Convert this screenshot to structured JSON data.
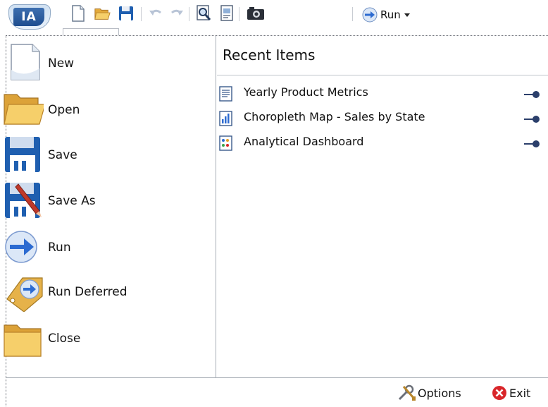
{
  "app": {
    "button_label": "IA"
  },
  "toolbar": {
    "icons": [
      "new-document-icon",
      "open-folder-icon",
      "save-disk-icon",
      "undo-icon",
      "redo-icon",
      "preview-icon",
      "report-icon",
      "camera-icon",
      "run-arrow-icon",
      "dropdown-caret-icon"
    ],
    "run_label": "Run"
  },
  "menu": {
    "items": [
      {
        "label": "New",
        "icon": "new-document-icon"
      },
      {
        "label": "Open",
        "icon": "open-folder-icon"
      },
      {
        "label": "Save",
        "icon": "save-disk-icon"
      },
      {
        "label": "Save As",
        "icon": "save-as-icon"
      },
      {
        "label": "Run",
        "icon": "run-arrow-icon"
      },
      {
        "label": "Run Deferred",
        "icon": "run-deferred-icon"
      },
      {
        "label": "Close",
        "icon": "close-folder-icon"
      }
    ]
  },
  "recent": {
    "title": "Recent Items",
    "items": [
      {
        "label": "Yearly Product Metrics",
        "icon": "report-doc-icon"
      },
      {
        "label": "Choropleth Map - Sales by State",
        "icon": "chart-doc-icon"
      },
      {
        "label": "Analytical Dashboard",
        "icon": "dashboard-doc-icon"
      }
    ]
  },
  "footer": {
    "options_label": "Options",
    "exit_label": "Exit"
  },
  "colors": {
    "folder": "#f2c35a",
    "disk": "#1f5fb0",
    "run_blue": "#2c6bd1",
    "exit_red": "#d9262a",
    "pin": "#2b3f6b"
  }
}
